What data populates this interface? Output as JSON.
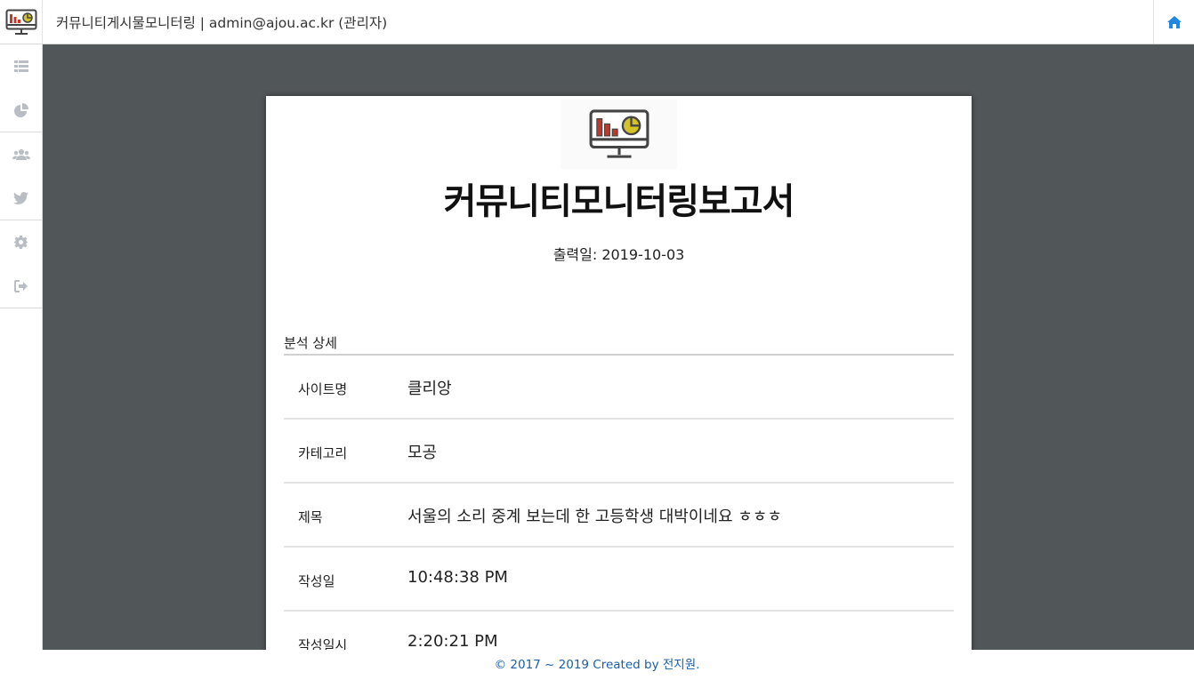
{
  "header": {
    "title": "커뮤니티게시물모니터링 | admin@ajou.ac.kr (관리자)",
    "logo_icon": "monitor-chart-icon",
    "home_icon": "home-icon"
  },
  "sidebar": {
    "items": [
      {
        "icon": "list-icon"
      },
      {
        "icon": "pie-chart-icon"
      },
      {
        "icon": "users-icon"
      },
      {
        "icon": "twitter-icon"
      },
      {
        "icon": "gear-icon"
      },
      {
        "icon": "sign-out-icon"
      }
    ]
  },
  "report": {
    "title": "커뮤니티모니터링보고서",
    "print_date": "출력일: 2019-10-03",
    "section_title": "분석 상세",
    "rows": [
      {
        "label": "사이트명",
        "value": "클리앙"
      },
      {
        "label": "카테고리",
        "value": "모공"
      },
      {
        "label": "제목",
        "value": "서울의 소리 중계 보는데 한 고등학생 대박이네요 ㅎㅎㅎ"
      },
      {
        "label": "작성일",
        "value": "10:48:38 PM"
      },
      {
        "label": "작성일시",
        "value": "2:20:21 PM"
      }
    ]
  },
  "footer": {
    "text": "© 2017 ~ 2019 Created by 전지원."
  },
  "colors": {
    "main_bg": "#515658",
    "accent": "#1e88e5",
    "footer_text": "#1a5fa8",
    "icon_gray": "#b9bec4"
  }
}
